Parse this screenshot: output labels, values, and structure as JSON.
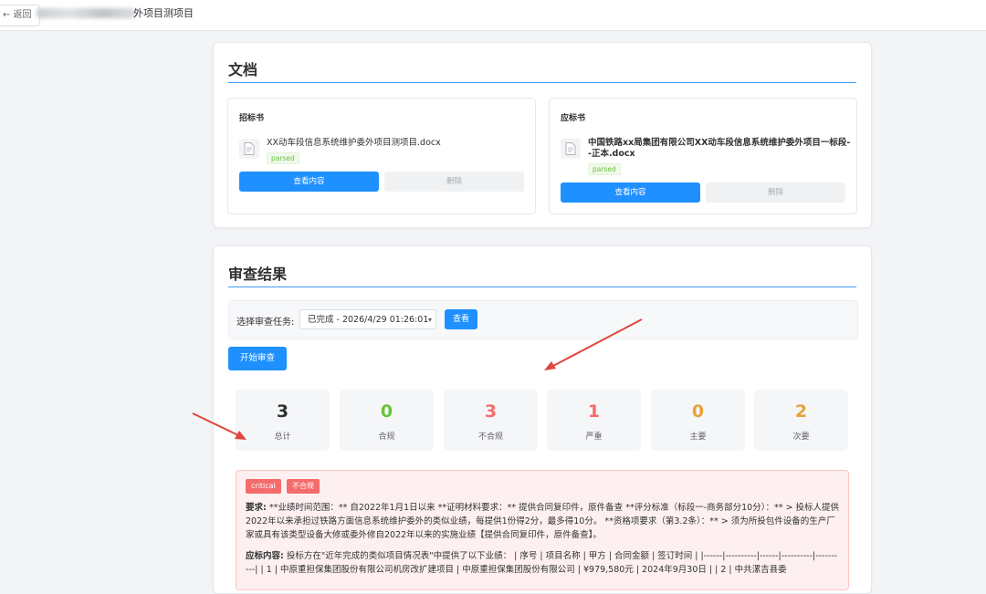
{
  "topbar": {
    "back_label": "← 返回",
    "title": "外项目测项目"
  },
  "documents": {
    "title": "文档",
    "tender": {
      "heading": "招标书",
      "file_name": "XX动车段信息系统维护委外项目测项目.docx",
      "status": "parsed",
      "view_label": "查看内容",
      "delete_label": "删除",
      "icon": "document-icon"
    },
    "bid": {
      "heading": "应标书",
      "file_name_line1": "中国铁路xx局集团有限公司XX动车段信息系统维护委外项目一标段-",
      "file_name_line2": "-正本.docx",
      "status": "parsed",
      "view_label": "查看内容",
      "delete_label": "删除",
      "icon": "document-icon"
    }
  },
  "review": {
    "title": "审查结果",
    "task_label": "选择审查任务:",
    "task_selected": "已完成 - 2026/4/29 01:26:01",
    "view_label": "查看",
    "start_label": "开始审查",
    "stats": [
      {
        "value": "3",
        "label": "总计",
        "color": "#303133"
      },
      {
        "value": "0",
        "label": "合规",
        "color": "#67c23a"
      },
      {
        "value": "3",
        "label": "不合规",
        "color": "#f56c6c"
      },
      {
        "value": "1",
        "label": "严重",
        "color": "#f56c6c"
      },
      {
        "value": "0",
        "label": "主要",
        "color": "#e6a23c"
      },
      {
        "value": "2",
        "label": "次要",
        "color": "#e6a23c"
      }
    ],
    "issue": {
      "severity_tag": "critical",
      "status_tag": "不合规",
      "req_label": "要求:",
      "req_text": "**业绩时间范围：** 自2022年1月1日以来 **证明材料要求：** 提供合同复印件，原件备查 **评分标准（标段一-商务部分10分）：** > 投标人提供2022年以来承担过铁路方面信息系统维护委外的类似业绩，每提供1份得2分，最多得10分。 **资格项要求（第3.2条）：** > 须为所投包件设备的生产厂家或具有该类型设备大修或委外修自2022年以来的实施业绩【提供合同复印件，原件备查】。",
      "resp_label": "应标内容:",
      "resp_text": "投标方在\"近年完成的类似项目情况表\"中提供了以下业绩： | 序号 | 项目名称 | 甲方 | 合同金额 | 签订时间 | |------|----------|------|----------|----------| | 1 | 中原重担保集团股份有限公司机房改扩建项目 | 中原重担保集团股份有限公司 | ¥979,580元 | 2024年9月30日 | | 2 | 中共漯吉县委"
    }
  },
  "colors": {
    "accent": "#1e90ff",
    "rule": "#409eff",
    "annotation_arrow": "#e0463c"
  }
}
